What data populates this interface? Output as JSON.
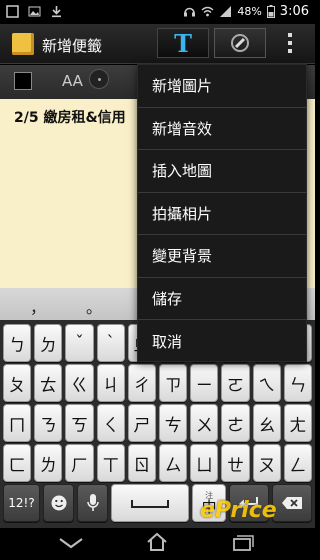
{
  "status": {
    "battery": "48%",
    "time": "3:06"
  },
  "app": {
    "title": "新增便籤"
  },
  "toolbar": {
    "text_tool": "T",
    "font_size_label": "AA"
  },
  "note": {
    "content": "2/5 繳房租&信用"
  },
  "menu": {
    "items": [
      "新增圖片",
      "新增音效",
      "插入地圖",
      "拍攝相片",
      "變更背景",
      "儲存",
      "取消"
    ]
  },
  "keyboard": {
    "candidates": [
      "，",
      "。"
    ],
    "row1": [
      "ㄅ",
      "ㄉ",
      "ˇ",
      "ˋ",
      "ㄓ",
      "ˊ",
      "˙",
      "ㄚ",
      "ㄞ",
      "ㄢ"
    ],
    "row2": [
      "ㄆ",
      "ㄊ",
      "ㄍ",
      "ㄐ",
      "ㄔ",
      "ㄗ",
      "ㄧ",
      "ㄛ",
      "ㄟ",
      "ㄣ"
    ],
    "row3": [
      "ㄇ",
      "ㄋ",
      "ㄎ",
      "ㄑ",
      "ㄕ",
      "ㄘ",
      "ㄨ",
      "ㄜ",
      "ㄠ",
      "ㄤ"
    ],
    "row4": [
      "ㄈ",
      "ㄌ",
      "ㄏ",
      "ㄒ",
      "ㄖ",
      "ㄙ",
      "ㄩ",
      "ㄝ",
      "ㄡ",
      "ㄥ"
    ],
    "symbols_key": "12!?",
    "ime_key": "中",
    "ime_key_super": "注"
  },
  "watermark": "ePrice",
  "colors": {
    "accent": "#3cb4ee",
    "note_bg": "#f9efc8",
    "menu_bg": "#1a1a1a"
  }
}
